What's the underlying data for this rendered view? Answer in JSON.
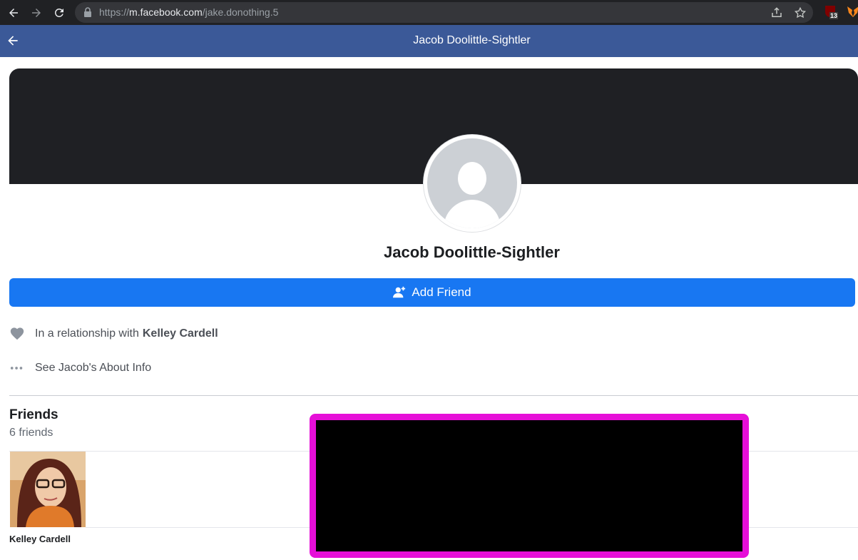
{
  "browser": {
    "url_scheme": "https://",
    "url_host": "m.facebook.com",
    "url_path": "/jake.donothing.5",
    "ext_badge": "13"
  },
  "header": {
    "title": "Jacob Doolittle-Sightler"
  },
  "profile": {
    "name": "Jacob Doolittle-Sightler",
    "add_friend_label": "Add Friend"
  },
  "info": {
    "relationship_prefix": "In a relationship with",
    "relationship_partner": "Kelley Cardell",
    "about_link": "See Jacob's About Info"
  },
  "friends": {
    "title": "Friends",
    "count": "6 friends",
    "items": [
      {
        "name": "Kelley Cardell"
      }
    ]
  },
  "colors": {
    "fb_header": "#3b5998",
    "primary_button": "#1877f2",
    "redaction_border": "#e60fd8"
  }
}
